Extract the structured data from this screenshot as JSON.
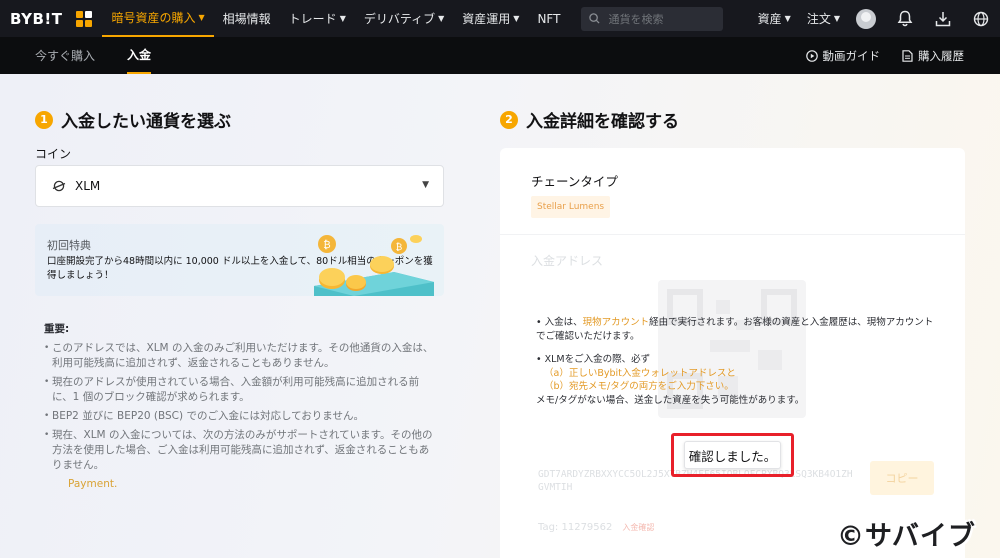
{
  "topbar": {
    "logo": "BYB!T",
    "nav": [
      {
        "label": "暗号資産の購入",
        "caret": true,
        "active": true
      },
      {
        "label": "相場情報",
        "caret": false
      },
      {
        "label": "トレード",
        "caret": true
      },
      {
        "label": "デリバティブ",
        "caret": true
      },
      {
        "label": "資産運用",
        "caret": true
      },
      {
        "label": "NFT",
        "caret": false
      }
    ],
    "search_placeholder": "通貨を検索",
    "right": [
      {
        "label": "資産",
        "caret": true
      },
      {
        "label": "注文",
        "caret": true
      }
    ],
    "icons": [
      "avatar",
      "bell-icon",
      "download-icon",
      "globe-icon"
    ]
  },
  "subbar": {
    "tabs": [
      {
        "label": "今すぐ購入",
        "active": false
      },
      {
        "label": "入金",
        "active": true
      }
    ],
    "video_guide": "動画ガイド",
    "purchase_history": "購入履歴"
  },
  "step1": {
    "num": "1",
    "title": "入金したい通貨を選ぶ",
    "coin_label": "コイン",
    "coin_value": "XLM"
  },
  "promo": {
    "title": "初回特典",
    "text": "口座開設完了から48時間以内に 10,000 ドル以上を入金して、80ドル相当のクーポンを獲得しましょう！"
  },
  "notes": {
    "title": "重要:",
    "items": [
      "このアドレスでは、XLM の入金のみご利用いただけます。その他通貨の入金は、利用可能残高に追加されず、返金されることもありません。",
      "現在のアドレスが使用されている場合、入金額が利用可能残高に追加される前に、1 個のブロック確認が求められます。",
      "BEP2 並びに BEP20 (BSC) でのご入金には対応しておりません。",
      "現在、XLM の入金については、次の方法のみがサポートされています。その他の方法を使用した場合、ご入金は利用可能残高に追加されず、返金されることもありません。"
    ],
    "link": "Payment."
  },
  "step2": {
    "num": "2",
    "title": "入金詳細を確認する",
    "chain_label": "チェーンタイプ",
    "chain_value": "Stellar Lumens",
    "address_label": "入金アドレス",
    "address_value": "GDT7ARDYZRBXXYCC5OL2J5XTBZH4FF65IOBLOFCPXBQ3LSQ3KB4O1ZHGVMTIH",
    "copy_label": "コピー",
    "tag_label": "Tag: 11279562",
    "tag_chip": "入金確認"
  },
  "overlay": {
    "line1_pre": "• 入金は、",
    "line1_link": "現物アカウント",
    "line1_post": "経由で実行されます。お客様の資産と入金履歴は、現物アカウントでご確認いただけます。",
    "line2": "• XLMをご入金の際、必ず",
    "line3": "（a）正しいBybit入金ウォレットアドレスと",
    "line4": "（b）宛先メモ/タグの両方をご入力下さい。",
    "line5": "メモ/タグがない場合、送金した資産を失う可能性があります。",
    "confirm": "確認しました。"
  },
  "watermark": "©サバイブ",
  "colors": {
    "accent": "#f7a600",
    "highlight": "#e8202a",
    "topbar": "#17181e"
  }
}
